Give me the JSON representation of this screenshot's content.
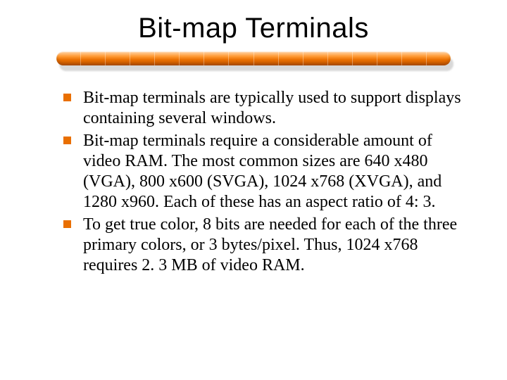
{
  "title": "Bit-map Terminals",
  "bullets": [
    "Bit-map terminals are typically used to support displays containing several windows.",
    "Bit-map terminals require a considerable amount of video RAM. The most common sizes are 640 x480 (VGA), 800 x600 (SVGA), 1024 x768 (XVGA), and 1280 x960. Each of these has an aspect ratio of 4: 3.",
    "To get true color, 8 bits are needed for each of the three primary colors, or 3 bytes/pixel. Thus, 1024 x768 requires 2. 3 MB of video RAM."
  ],
  "accent_color": "#e96f00"
}
